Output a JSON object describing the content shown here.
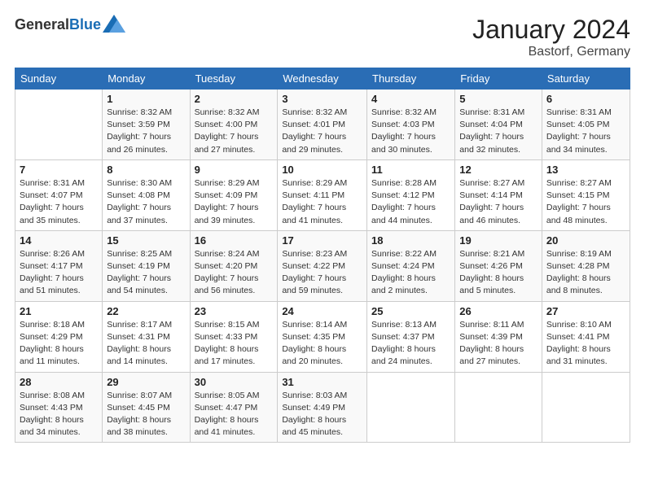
{
  "header": {
    "logo_general": "General",
    "logo_blue": "Blue",
    "main_title": "January 2024",
    "subtitle": "Bastorf, Germany"
  },
  "calendar": {
    "days_of_week": [
      "Sunday",
      "Monday",
      "Tuesday",
      "Wednesday",
      "Thursday",
      "Friday",
      "Saturday"
    ],
    "weeks": [
      [
        {
          "day": "",
          "info": ""
        },
        {
          "day": "1",
          "info": "Sunrise: 8:32 AM\nSunset: 3:59 PM\nDaylight: 7 hours\nand 26 minutes."
        },
        {
          "day": "2",
          "info": "Sunrise: 8:32 AM\nSunset: 4:00 PM\nDaylight: 7 hours\nand 27 minutes."
        },
        {
          "day": "3",
          "info": "Sunrise: 8:32 AM\nSunset: 4:01 PM\nDaylight: 7 hours\nand 29 minutes."
        },
        {
          "day": "4",
          "info": "Sunrise: 8:32 AM\nSunset: 4:03 PM\nDaylight: 7 hours\nand 30 minutes."
        },
        {
          "day": "5",
          "info": "Sunrise: 8:31 AM\nSunset: 4:04 PM\nDaylight: 7 hours\nand 32 minutes."
        },
        {
          "day": "6",
          "info": "Sunrise: 8:31 AM\nSunset: 4:05 PM\nDaylight: 7 hours\nand 34 minutes."
        }
      ],
      [
        {
          "day": "7",
          "info": "Sunrise: 8:31 AM\nSunset: 4:07 PM\nDaylight: 7 hours\nand 35 minutes."
        },
        {
          "day": "8",
          "info": "Sunrise: 8:30 AM\nSunset: 4:08 PM\nDaylight: 7 hours\nand 37 minutes."
        },
        {
          "day": "9",
          "info": "Sunrise: 8:29 AM\nSunset: 4:09 PM\nDaylight: 7 hours\nand 39 minutes."
        },
        {
          "day": "10",
          "info": "Sunrise: 8:29 AM\nSunset: 4:11 PM\nDaylight: 7 hours\nand 41 minutes."
        },
        {
          "day": "11",
          "info": "Sunrise: 8:28 AM\nSunset: 4:12 PM\nDaylight: 7 hours\nand 44 minutes."
        },
        {
          "day": "12",
          "info": "Sunrise: 8:27 AM\nSunset: 4:14 PM\nDaylight: 7 hours\nand 46 minutes."
        },
        {
          "day": "13",
          "info": "Sunrise: 8:27 AM\nSunset: 4:15 PM\nDaylight: 7 hours\nand 48 minutes."
        }
      ],
      [
        {
          "day": "14",
          "info": "Sunrise: 8:26 AM\nSunset: 4:17 PM\nDaylight: 7 hours\nand 51 minutes."
        },
        {
          "day": "15",
          "info": "Sunrise: 8:25 AM\nSunset: 4:19 PM\nDaylight: 7 hours\nand 54 minutes."
        },
        {
          "day": "16",
          "info": "Sunrise: 8:24 AM\nSunset: 4:20 PM\nDaylight: 7 hours\nand 56 minutes."
        },
        {
          "day": "17",
          "info": "Sunrise: 8:23 AM\nSunset: 4:22 PM\nDaylight: 7 hours\nand 59 minutes."
        },
        {
          "day": "18",
          "info": "Sunrise: 8:22 AM\nSunset: 4:24 PM\nDaylight: 8 hours\nand 2 minutes."
        },
        {
          "day": "19",
          "info": "Sunrise: 8:21 AM\nSunset: 4:26 PM\nDaylight: 8 hours\nand 5 minutes."
        },
        {
          "day": "20",
          "info": "Sunrise: 8:19 AM\nSunset: 4:28 PM\nDaylight: 8 hours\nand 8 minutes."
        }
      ],
      [
        {
          "day": "21",
          "info": "Sunrise: 8:18 AM\nSunset: 4:29 PM\nDaylight: 8 hours\nand 11 minutes."
        },
        {
          "day": "22",
          "info": "Sunrise: 8:17 AM\nSunset: 4:31 PM\nDaylight: 8 hours\nand 14 minutes."
        },
        {
          "day": "23",
          "info": "Sunrise: 8:15 AM\nSunset: 4:33 PM\nDaylight: 8 hours\nand 17 minutes."
        },
        {
          "day": "24",
          "info": "Sunrise: 8:14 AM\nSunset: 4:35 PM\nDaylight: 8 hours\nand 20 minutes."
        },
        {
          "day": "25",
          "info": "Sunrise: 8:13 AM\nSunset: 4:37 PM\nDaylight: 8 hours\nand 24 minutes."
        },
        {
          "day": "26",
          "info": "Sunrise: 8:11 AM\nSunset: 4:39 PM\nDaylight: 8 hours\nand 27 minutes."
        },
        {
          "day": "27",
          "info": "Sunrise: 8:10 AM\nSunset: 4:41 PM\nDaylight: 8 hours\nand 31 minutes."
        }
      ],
      [
        {
          "day": "28",
          "info": "Sunrise: 8:08 AM\nSunset: 4:43 PM\nDaylight: 8 hours\nand 34 minutes."
        },
        {
          "day": "29",
          "info": "Sunrise: 8:07 AM\nSunset: 4:45 PM\nDaylight: 8 hours\nand 38 minutes."
        },
        {
          "day": "30",
          "info": "Sunrise: 8:05 AM\nSunset: 4:47 PM\nDaylight: 8 hours\nand 41 minutes."
        },
        {
          "day": "31",
          "info": "Sunrise: 8:03 AM\nSunset: 4:49 PM\nDaylight: 8 hours\nand 45 minutes."
        },
        {
          "day": "",
          "info": ""
        },
        {
          "day": "",
          "info": ""
        },
        {
          "day": "",
          "info": ""
        }
      ]
    ]
  }
}
